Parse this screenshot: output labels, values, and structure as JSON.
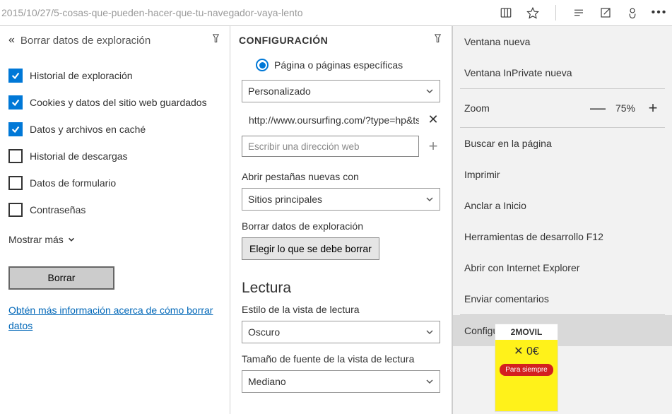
{
  "url": "2015/10/27/5-cosas-que-pueden-hacer-que-tu-navegador-vaya-lento",
  "left_panel": {
    "title": "Borrar datos de exploración",
    "items": [
      {
        "label": "Historial de exploración",
        "checked": true
      },
      {
        "label": "Cookies y datos del sitio web guardados",
        "checked": true
      },
      {
        "label": "Datos y archivos en caché",
        "checked": true
      },
      {
        "label": "Historial de descargas",
        "checked": false
      },
      {
        "label": "Datos de formulario",
        "checked": false
      },
      {
        "label": "Contraseñas",
        "checked": false
      }
    ],
    "show_more": "Mostrar más",
    "clear_button": "Borrar",
    "link": "Obtén más información acerca de cómo borrar datos"
  },
  "settings_panel": {
    "title": "CONFIGURACIÓN",
    "radio_label": "Página o páginas específicas",
    "startup_select": "Personalizado",
    "page_url": "http://www.oursurfing.com/?type=hp&ts",
    "add_page_placeholder": "Escribir una dirección web",
    "new_tabs_label": "Abrir pestañas nuevas con",
    "new_tabs_select": "Sitios principales",
    "clear_data_label": "Borrar datos de exploración",
    "clear_data_button": "Elegir lo que se debe borrar",
    "reading_heading": "Lectura",
    "reading_style_label": "Estilo de la vista de lectura",
    "reading_style_select": "Oscuro",
    "reading_size_label": "Tamaño de fuente de la vista de lectura",
    "reading_size_select": "Mediano"
  },
  "menu": {
    "items_top": [
      "Ventana nueva",
      "Ventana InPrivate nueva"
    ],
    "zoom_label": "Zoom",
    "zoom_value": "75%",
    "items_mid": [
      "Buscar en la página",
      "Imprimir",
      "Anclar a Inicio",
      "Herramientas de desarrollo F12",
      "Abrir con Internet Explorer",
      "Enviar comentarios"
    ],
    "settings_item": "Configuración"
  },
  "ad": {
    "top": "2MOVIL",
    "mid": "✕ 0€",
    "red": "Para siempre"
  }
}
